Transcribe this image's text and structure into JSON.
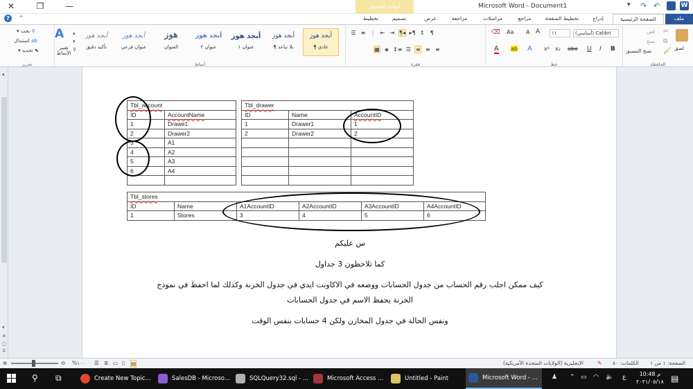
{
  "window": {
    "title": "Microsoft Word - Document1",
    "context_tab_group": "أدوات الجدول"
  },
  "ribbon_tabs": [
    {
      "label": "ملف",
      "key": "file"
    },
    {
      "label": "الصفحة الرئيسية",
      "key": "home"
    },
    {
      "label": "إدراج",
      "key": "insert"
    },
    {
      "label": "تخطيط الصفحة",
      "key": "page-layout"
    },
    {
      "label": "مراجع",
      "key": "references"
    },
    {
      "label": "مراسلات",
      "key": "mailings"
    },
    {
      "label": "مراجعة",
      "key": "review"
    },
    {
      "label": "عرض",
      "key": "view"
    },
    {
      "label": "تصميم",
      "key": "design"
    },
    {
      "label": "تخطيط",
      "key": "layout"
    }
  ],
  "clipboard": {
    "label": "الحافظة",
    "paste": "لصق",
    "cut": "قص",
    "copy": "نسخ",
    "format_painter": "نسخ التنسيق"
  },
  "font": {
    "label": "خط",
    "name": "(أساسي) Calibri",
    "size": "١١",
    "grow": "A",
    "shrink": "A",
    "clear": "Aa",
    "bold": "B",
    "italic": "I",
    "underline": "U",
    "strike": "abe",
    "subscript": "x₂",
    "superscript": "x²",
    "text_effect": "A",
    "highlight": "ab",
    "color": "A"
  },
  "paragraph": {
    "label": "فقرة",
    "show_marks": "¶"
  },
  "styles": {
    "label": "أنماط",
    "change_styles": "تغيير الأنماط",
    "items": [
      {
        "sample": "أبجد هوز",
        "name": "¶ عادي",
        "selected": true
      },
      {
        "sample": "أبجد هوز",
        "name": "¶ بلا تباعد",
        "selected": false
      },
      {
        "sample": "أبجد هوز",
        "name": "عنوان ١",
        "selected": false
      },
      {
        "sample": "أبجد هوز",
        "name": "عنوان ٢",
        "selected": false
      },
      {
        "sample": "هوز",
        "name": "العنوان",
        "selected": false
      },
      {
        "sample": "أبجد هوز",
        "name": "عنوان فرعي",
        "selected": false
      },
      {
        "sample": "أبجد هوز",
        "name": "تأكيد دقيق",
        "selected": false
      }
    ]
  },
  "editing": {
    "label": "تحرير",
    "find": "بحث",
    "replace": "استبدال",
    "select": "تحديد"
  },
  "tables": {
    "account": {
      "caption": "Tbl_account",
      "headers": [
        "ID",
        "AccountName"
      ],
      "rows": [
        [
          "1",
          "Drawe1"
        ],
        [
          "2",
          "Drawer2"
        ],
        [
          "3",
          "A1"
        ],
        [
          "4",
          "A2"
        ],
        [
          "5",
          "A3"
        ],
        [
          "6",
          "A4"
        ],
        [
          "",
          ""
        ]
      ]
    },
    "drawer": {
      "caption": "Tbl_drawer",
      "headers": [
        "ID",
        "Name",
        "AccountID"
      ],
      "rows": [
        [
          "1",
          "Drawer1",
          "1"
        ],
        [
          "2",
          "Drawer2",
          "2"
        ],
        [
          "",
          "",
          ""
        ],
        [
          "",
          "",
          ""
        ],
        [
          "",
          "",
          ""
        ],
        [
          "",
          "",
          ""
        ],
        [
          "",
          "",
          ""
        ]
      ]
    },
    "stores": {
      "caption": "Tbl_stores",
      "headers": [
        "ID",
        "Name",
        "A1AccountID",
        "A2AccountID",
        "A3AccountID",
        "A4AccountID"
      ],
      "rows": [
        [
          "1",
          "Stores",
          "3",
          "4",
          "5",
          "6"
        ]
      ]
    }
  },
  "body_text": {
    "line1": "س عليكم",
    "line2": "كما تلاحظون 3 جداول",
    "line3": "كيف ممكن اجلب رقم الحساب من جدول الحسابات ووضعه في الاكاونت ايدي في جدول الخزنة وكذلك لما احفظ في نموذج",
    "line4": "الخزنة يحفظ الاسم في جدول الحسابات",
    "line5": "ونفس الحالة في جدول المخازن ولكن 4 حسابات بنفس الوقت"
  },
  "status_bar": {
    "page": "الصفحة: ١ من ١",
    "words": "الكلمات: ٨٠",
    "language": "الإنجليزية (الولايات المتحدة الأمريكية)",
    "zoom": "%١٠٠"
  },
  "taskbar": {
    "apps": [
      {
        "label": "Create New Topic...",
        "color": "#e4452f",
        "active": false
      },
      {
        "label": "SalesDB - Microso...",
        "color": "#8c5ad2",
        "active": false
      },
      {
        "label": "SQLQuery32.sql - ...",
        "color": "#b0b0b0",
        "active": false
      },
      {
        "label": "Microsoft Access ...",
        "color": "#a4373a",
        "active": false
      },
      {
        "label": "Untitled - Paint",
        "color": "#d9c36a",
        "active": false
      },
      {
        "label": "Microsoft Word - ...",
        "color": "#2b579a",
        "active": true
      }
    ],
    "clock_time": "10:48 م",
    "clock_date": "٢٠٢١/٠٥/١٨",
    "lang_indicator": "ع"
  }
}
